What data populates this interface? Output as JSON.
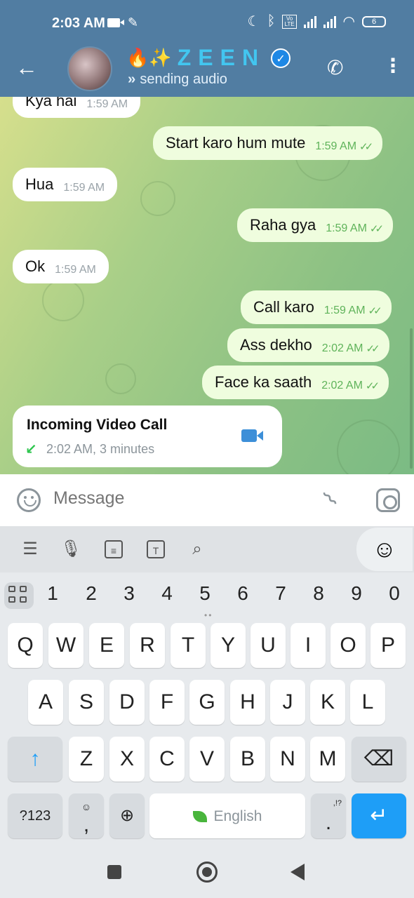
{
  "status_bar": {
    "time": "2:03 AM",
    "battery": "6"
  },
  "header": {
    "title_emoji": "🔥✨",
    "title": "ZEEN",
    "status_text": "sending audio"
  },
  "messages": [
    {
      "direction": "in",
      "text": "Kya hai",
      "time": "1:59 AM"
    },
    {
      "direction": "out",
      "text": "Start karo hum mute",
      "time": "1:59 AM"
    },
    {
      "direction": "in",
      "text": "Hua",
      "time": "1:59 AM"
    },
    {
      "direction": "out",
      "text": "Raha gya",
      "time": "1:59 AM"
    },
    {
      "direction": "in",
      "text": "Ok",
      "time": "1:59 AM"
    },
    {
      "direction": "out",
      "text": "Call karo",
      "time": "1:59 AM"
    },
    {
      "direction": "out",
      "text": "Ass dekho",
      "time": "2:02 AM"
    },
    {
      "direction": "out",
      "text": "Face ka saath",
      "time": "2:02 AM"
    }
  ],
  "call_card": {
    "title": "Incoming Video Call",
    "detail": "2:02 AM, 3 minutes"
  },
  "input": {
    "placeholder": "Message"
  },
  "keyboard": {
    "numbers": [
      "1",
      "2",
      "3",
      "4",
      "5",
      "6",
      "7",
      "8",
      "9",
      "0"
    ],
    "row1": [
      "Q",
      "W",
      "E",
      "R",
      "T",
      "Y",
      "U",
      "I",
      "O",
      "P"
    ],
    "row2": [
      "A",
      "S",
      "D",
      "F",
      "G",
      "H",
      "J",
      "K",
      "L"
    ],
    "row3": [
      "Z",
      "X",
      "C",
      "V",
      "B",
      "N",
      "M"
    ],
    "symbols_key": "?123",
    "emoji_key": ",",
    "space_label": "English",
    "period_key": ".",
    "punct_hint": ",!?"
  },
  "colors": {
    "header_bg": "#517da2",
    "title_color": "#42c6f0",
    "outgoing_bubble": "#effdde",
    "enter_key": "#1e9ef7"
  }
}
